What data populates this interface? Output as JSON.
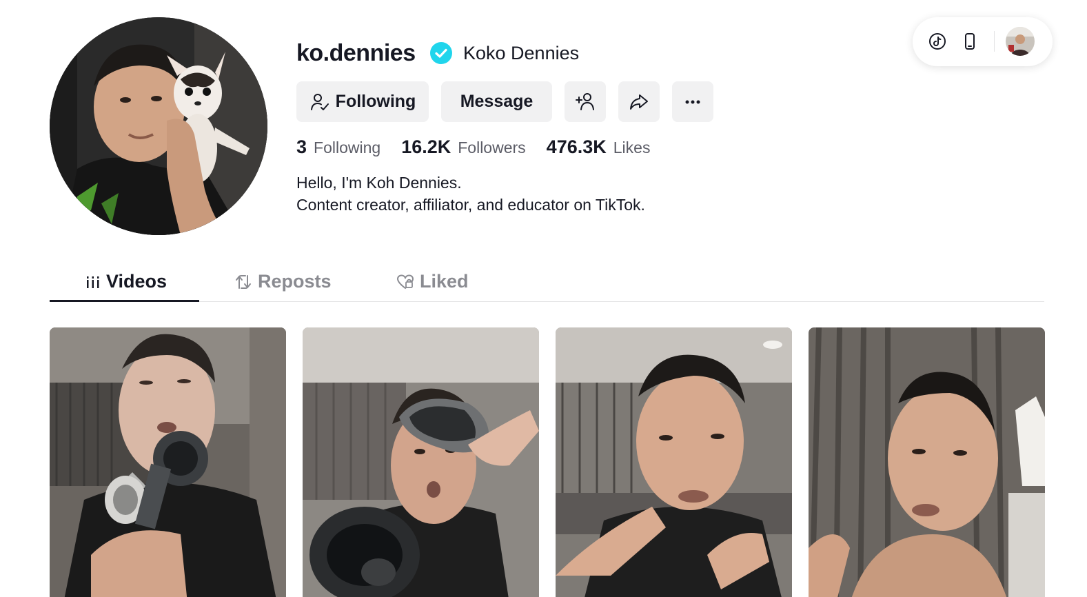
{
  "header": {
    "icons": [
      "tiktok-icon",
      "mobile-icon"
    ],
    "avatar": "user-avatar"
  },
  "profile": {
    "username": "ko.dennies",
    "verified": true,
    "nickname": "Koko Dennies",
    "buttons": {
      "following_label": "Following",
      "message_label": "Message",
      "add_friend_icon": "add-friend-icon",
      "share_icon": "share-icon",
      "more_icon": "more-icon"
    },
    "stats": [
      {
        "value": "3",
        "label": "Following"
      },
      {
        "value": "16.2K",
        "label": "Followers"
      },
      {
        "value": "476.3K",
        "label": "Likes"
      }
    ],
    "bio": [
      "Hello, I'm Koh Dennies.",
      "Content creator, affiliator, and educator on TikTok."
    ]
  },
  "tabs": [
    {
      "label": "Videos",
      "icon": "grid-icon",
      "active": true
    },
    {
      "label": "Reposts",
      "icon": "repost-icon",
      "active": false
    },
    {
      "label": "Liked",
      "icon": "heart-icon",
      "active": false
    }
  ],
  "colors": {
    "verified": "#20d5ec",
    "text": "#161823",
    "muted": "#8a8b91",
    "button_bg": "#f1f1f2"
  },
  "videos": [
    "video-thumbnail-1",
    "video-thumbnail-2",
    "video-thumbnail-3",
    "video-thumbnail-4"
  ]
}
